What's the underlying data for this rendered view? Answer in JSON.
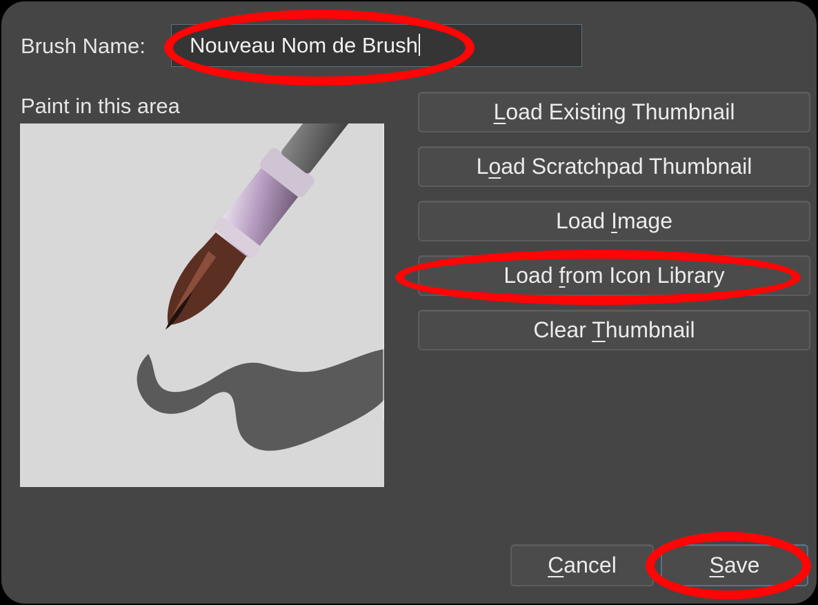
{
  "dialog": {
    "brush_name_label": "Brush Name:",
    "brush_name_value": "Nouveau Nom de Brush",
    "paint_area_label": "Paint in this area"
  },
  "buttons": {
    "load_existing": {
      "pre": "",
      "key": "L",
      "post": "oad Existing Thumbnail"
    },
    "load_scratchpad": {
      "pre": "L",
      "key": "o",
      "post": "ad Scratchpad Thumbnail"
    },
    "load_image": {
      "pre": "Load ",
      "key": "I",
      "post": "mage"
    },
    "load_icon_library": {
      "pre": "Load ",
      "key": "f",
      "post": "rom Icon Library"
    },
    "clear_thumbnail": {
      "pre": "Clear ",
      "key": "T",
      "post": "humbnail"
    },
    "cancel": {
      "pre": "",
      "key": "C",
      "post": "ancel"
    },
    "save": {
      "pre": "",
      "key": "S",
      "post": "ave"
    }
  },
  "colors": {
    "background": "#454545",
    "annotation": "#ff0505",
    "canvas": "#d8d8d8"
  },
  "icons": [
    "paintbrush-icon",
    "brush-stroke"
  ]
}
